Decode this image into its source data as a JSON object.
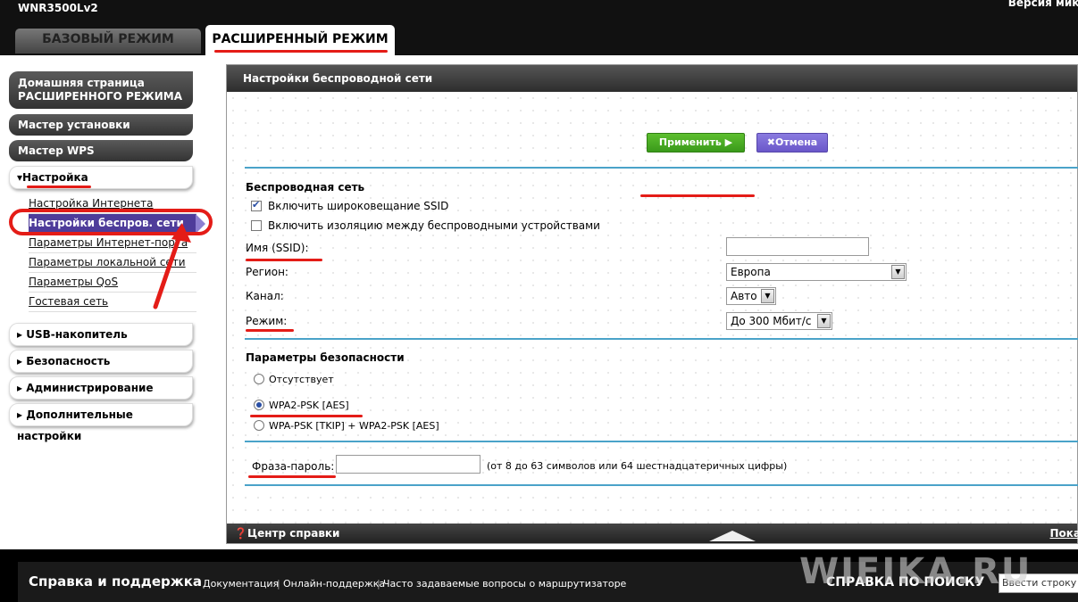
{
  "header": {
    "model": "WNR3500Lv2",
    "version_text": "Версия микр",
    "tabs": [
      {
        "label": "БАЗОВЫЙ РЕЖИМ"
      },
      {
        "label": "РАСШИРЕННЫЙ РЕЖИМ"
      }
    ]
  },
  "sidebar": {
    "home": "Домашняя страница РАСШИРЕННОГО РЕЖИМА",
    "wizard": "Мастер установки",
    "wps": "Мастер WPS",
    "setup": "▾Настройка",
    "sub_items": [
      "Настройка Интернета",
      "Настройки беспров. сети",
      "Параметры Интернет-порта",
      "Параметры локальной сети",
      "Параметры QoS",
      "Гостевая сеть"
    ],
    "collapsed": [
      "▸ USB-накопитель",
      "▸ Безопасность",
      "▸ Администрирование",
      "▸ Дополнительные настройки"
    ]
  },
  "panel": {
    "title": "Настройки беспроводной сети",
    "apply": "Применить ▶",
    "cancel": "✖Отмена",
    "wireless_section": "Беспроводная сеть",
    "ssid_broadcast": "Включить широковещание SSID",
    "isolation": "Включить изоляцию между беспроводными устройствами",
    "ssid_label": "Имя (SSID):",
    "ssid_value": "",
    "region_label": "Регион:",
    "region_value": "Европа",
    "channel_label": "Канал:",
    "channel_value": "Авто",
    "mode_label": "Режим:",
    "mode_value": "До 300 Мбит/с",
    "security_section": "Параметры безопасности",
    "sec_none": "Отсутствует",
    "sec_wpa2": "WPA2-PSK [AES]",
    "sec_mixed": "WPA-PSK [TKIP] + WPA2-PSK [AES]",
    "passphrase_label": "Фраза-пароль:",
    "passphrase_value": "",
    "passphrase_hint": "(от 8 до 63 символов или 64 шестнадцатеричных цифры)",
    "help_center": "❓Центр справки",
    "show": "Пока"
  },
  "footer": {
    "title": "Справка и поддержка",
    "links": [
      "Документация",
      "Онлайн-поддержка",
      "Часто задаваемые вопросы о маршрутизаторе"
    ],
    "search_label": "СПРАВКА ПО ПОИСКУ",
    "search_placeholder": "Ввести строку"
  },
  "watermark": "WIFIKA.RU",
  "colors": {
    "accent_purple": "#4e3c9a",
    "apply_green": "#3a9a1a",
    "divider_blue": "#4aa3c9",
    "annotation_red": "#e41c17"
  }
}
